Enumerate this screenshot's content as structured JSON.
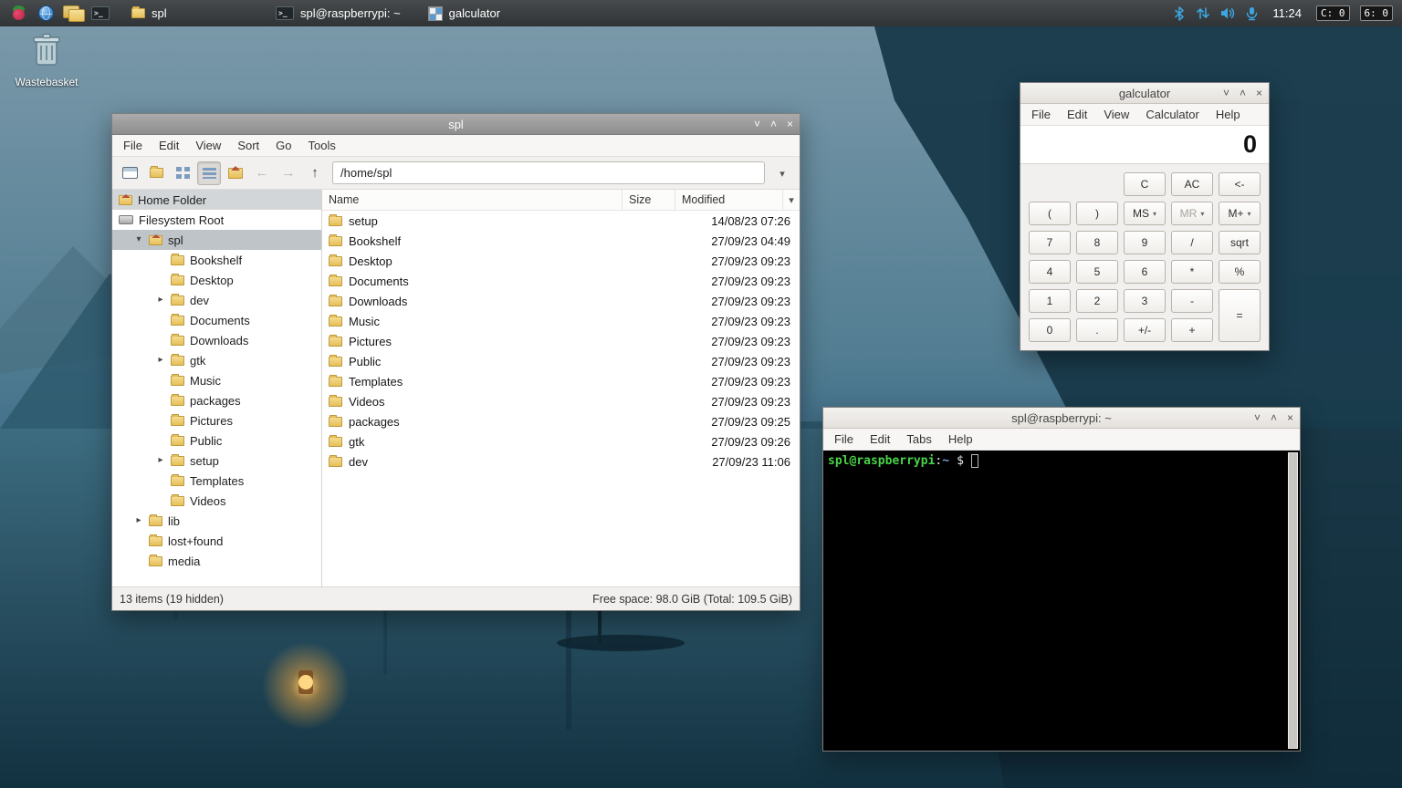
{
  "window_controls": {
    "shade": "˅",
    "maximize": "˄",
    "close": "×"
  },
  "taskbar": {
    "windows": [
      {
        "label": "spl"
      },
      {
        "label": "spl@raspberrypi: ~"
      },
      {
        "label": "galculator"
      }
    ],
    "tray": {
      "clock": "11:24",
      "badges": [
        "C: 0",
        "6: 0"
      ]
    }
  },
  "desktop": {
    "wastebasket": "Wastebasket"
  },
  "file_manager": {
    "title": "spl",
    "menu": [
      "File",
      "Edit",
      "View",
      "Sort",
      "Go",
      "Tools"
    ],
    "path": "/home/spl",
    "places": [
      "Home Folder",
      "Filesystem Root"
    ],
    "tree": [
      {
        "label": "spl"
      },
      {
        "label": "Bookshelf"
      },
      {
        "label": "Desktop"
      },
      {
        "label": "dev"
      },
      {
        "label": "Documents"
      },
      {
        "label": "Downloads"
      },
      {
        "label": "gtk"
      },
      {
        "label": "Music"
      },
      {
        "label": "packages"
      },
      {
        "label": "Pictures"
      },
      {
        "label": "Public"
      },
      {
        "label": "setup"
      },
      {
        "label": "Templates"
      },
      {
        "label": "Videos"
      },
      {
        "label": "lib"
      },
      {
        "label": "lost+found"
      },
      {
        "label": "media"
      }
    ],
    "columns": [
      "Name",
      "Size",
      "Modified"
    ],
    "rows": [
      {
        "name": "setup",
        "size": "",
        "modified": "14/08/23 07:26"
      },
      {
        "name": "Bookshelf",
        "size": "",
        "modified": "27/09/23 04:49"
      },
      {
        "name": "Desktop",
        "size": "",
        "modified": "27/09/23 09:23"
      },
      {
        "name": "Documents",
        "size": "",
        "modified": "27/09/23 09:23"
      },
      {
        "name": "Downloads",
        "size": "",
        "modified": "27/09/23 09:23"
      },
      {
        "name": "Music",
        "size": "",
        "modified": "27/09/23 09:23"
      },
      {
        "name": "Pictures",
        "size": "",
        "modified": "27/09/23 09:23"
      },
      {
        "name": "Public",
        "size": "",
        "modified": "27/09/23 09:23"
      },
      {
        "name": "Templates",
        "size": "",
        "modified": "27/09/23 09:23"
      },
      {
        "name": "Videos",
        "size": "",
        "modified": "27/09/23 09:23"
      },
      {
        "name": "packages",
        "size": "",
        "modified": "27/09/23 09:25"
      },
      {
        "name": "gtk",
        "size": "",
        "modified": "27/09/23 09:26"
      },
      {
        "name": "dev",
        "size": "",
        "modified": "27/09/23 11:06"
      }
    ],
    "status_left": "13 items (19 hidden)",
    "status_right": "Free space: 98.0 GiB (Total: 109.5 GiB)"
  },
  "calculator": {
    "title": "galculator",
    "menu": [
      "File",
      "Edit",
      "View",
      "Calculator",
      "Help"
    ],
    "display": "0",
    "row1": [
      "C",
      "AC",
      "<-"
    ],
    "row2": [
      "(",
      ")",
      "MS",
      "MR",
      "M+"
    ],
    "row3": [
      "7",
      "8",
      "9",
      "/",
      "sqrt"
    ],
    "row4": [
      "4",
      "5",
      "6",
      "*",
      "%"
    ],
    "row5": [
      "1",
      "2",
      "3",
      "-",
      "="
    ],
    "row6": [
      "0",
      ".",
      "+/-",
      "+"
    ]
  },
  "terminal": {
    "title": "spl@raspberrypi: ~",
    "menu": [
      "File",
      "Edit",
      "Tabs",
      "Help"
    ],
    "prompt": {
      "user_host": "spl@raspberrypi",
      "separator": ":",
      "path": "~",
      "symbol": "$"
    }
  },
  "colors": {
    "accent_blue": "#3da5e0",
    "folder_yellow": "#e6bf58",
    "prompt_green": "#4ad34a",
    "prompt_blue": "#729fcf",
    "selection_gray": "#bfc4c8"
  }
}
